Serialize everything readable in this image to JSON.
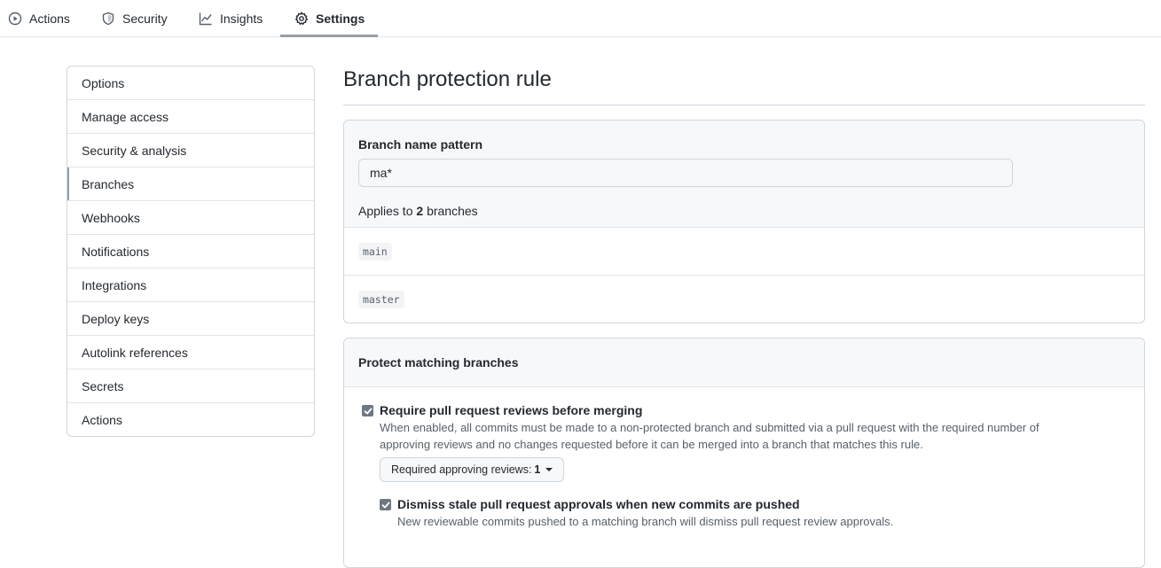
{
  "nav": {
    "tabs": [
      {
        "label": "Actions",
        "icon": "play-icon"
      },
      {
        "label": "Security",
        "icon": "shield-icon"
      },
      {
        "label": "Insights",
        "icon": "graph-icon"
      },
      {
        "label": "Settings",
        "icon": "gear-icon",
        "selected": true
      }
    ]
  },
  "sidebar": {
    "items": [
      {
        "label": "Options"
      },
      {
        "label": "Manage access"
      },
      {
        "label": "Security & analysis"
      },
      {
        "label": "Branches",
        "selected": true
      },
      {
        "label": "Webhooks"
      },
      {
        "label": "Notifications"
      },
      {
        "label": "Integrations"
      },
      {
        "label": "Deploy keys"
      },
      {
        "label": "Autolink references"
      },
      {
        "label": "Secrets"
      },
      {
        "label": "Actions"
      }
    ]
  },
  "main": {
    "title": "Branch protection rule",
    "pattern": {
      "label": "Branch name pattern",
      "value": "ma*",
      "applies_prefix": "Applies to",
      "applies_count": "2",
      "applies_suffix": "branches",
      "branches": [
        "main",
        "master"
      ]
    },
    "protect": {
      "heading": "Protect matching branches",
      "require_reviews": {
        "checked": true,
        "title": "Require pull request reviews before merging",
        "description_line1": "When enabled, all commits must be made to a non-protected branch and submitted via a pull request with the required number of",
        "description_line2": "approving reviews and no changes requested before it can be merged into a branch that matches this rule.",
        "select_label": "Required approving reviews:",
        "select_value": "1"
      },
      "dismiss_stale": {
        "checked": true,
        "title": "Dismiss stale pull request approvals when new commits are pushed",
        "description": "New reviewable commits pushed to a matching branch will dismiss pull request review approvals."
      }
    }
  },
  "colors": {
    "border": "#d0d7de",
    "muted_bg": "#f6f8fa",
    "checkbox": "#6e7781",
    "selected_marker": "#959da5"
  }
}
